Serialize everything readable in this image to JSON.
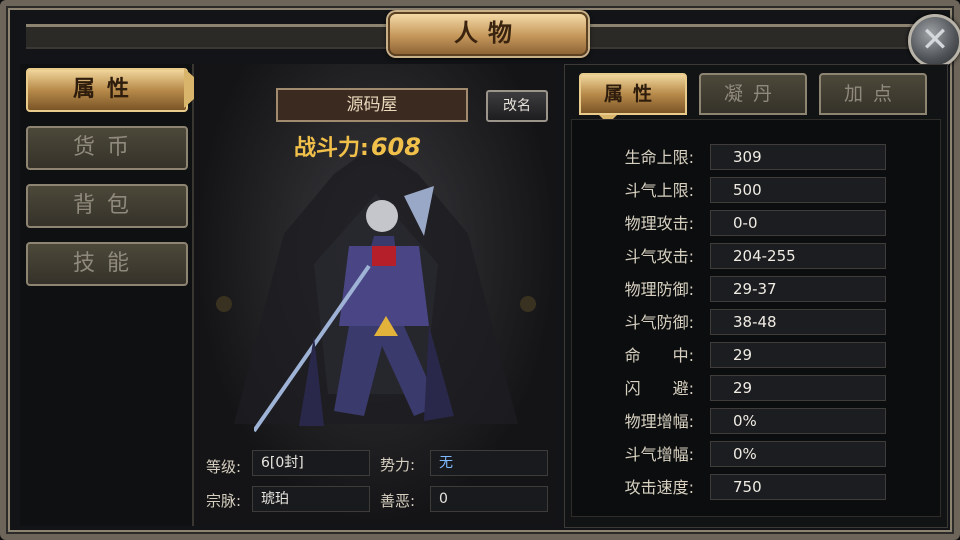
{
  "window": {
    "title": "人物",
    "close_glyph": "✕"
  },
  "nav": [
    {
      "label": "属性",
      "active": true
    },
    {
      "label": "货币",
      "active": false
    },
    {
      "label": "背包",
      "active": false
    },
    {
      "label": "技能",
      "active": false
    }
  ],
  "character": {
    "name": "源码屋",
    "rename_label": "改名",
    "power_label": "战斗力:",
    "power_value": "608"
  },
  "info": {
    "level_label": "等级:",
    "level_value": "6[0封]",
    "faction_label": "势力:",
    "faction_value": "无",
    "sect_label": "宗脉:",
    "sect_value": "琥珀",
    "morality_label": "善恶:",
    "morality_value": "0"
  },
  "tabs": [
    {
      "label": "属性",
      "active": true
    },
    {
      "label": "凝丹",
      "active": false
    },
    {
      "label": "加点",
      "active": false
    }
  ],
  "stats": [
    {
      "label": "生命上限:",
      "value": "309"
    },
    {
      "label": "斗气上限:",
      "value": "500"
    },
    {
      "label": "物理攻击:",
      "value": "0-0"
    },
    {
      "label": "斗气攻击:",
      "value": "204-255"
    },
    {
      "label": "物理防御:",
      "value": "29-37"
    },
    {
      "label": "斗气防御:",
      "value": "38-48"
    },
    {
      "label": "命　　中:",
      "value": "29"
    },
    {
      "label": "闪　　避:",
      "value": "29"
    },
    {
      "label": "物理增幅:",
      "value": "0%"
    },
    {
      "label": "斗气增幅:",
      "value": "0%"
    },
    {
      "label": "攻击速度:",
      "value": "750"
    }
  ],
  "colors": {
    "gold": "#f1c04a",
    "faction_blue": "#7fb9ff"
  },
  "icons": {
    "close": "close-icon",
    "hero": "character-model"
  }
}
